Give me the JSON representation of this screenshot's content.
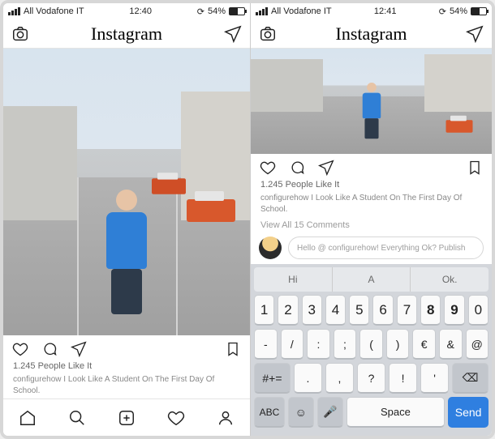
{
  "left": {
    "status": {
      "carrier": "All Vodafone IT",
      "time": "12:40",
      "battery": "54%"
    },
    "header": {
      "logo": "Instagram"
    },
    "post": {
      "likes": "1.245 People Like It",
      "caption": "configurehow I Look Like A Student On The First Day Of School."
    },
    "tabs": [
      "home",
      "search",
      "create",
      "activity",
      "profile"
    ]
  },
  "right": {
    "status": {
      "carrier": "All Vodafone IT",
      "time": "12:41",
      "battery": "54%",
      "battery_icon": "54%"
    },
    "header": {
      "logo": "Instagram"
    },
    "post": {
      "likes": "1.245 People Like It",
      "caption": "configurehow I Look Like A Student On The First Day Of School.",
      "view_comments": "View All 15 Comments",
      "comment_placeholder": "Hello @ configurehow! Everything Ok? Publish"
    },
    "keyboard": {
      "suggestions": [
        "Hi",
        "A",
        "Ok."
      ],
      "row1": [
        "1",
        "2",
        "3",
        "4",
        "5",
        "6",
        "7",
        "8",
        "9",
        "0"
      ],
      "row2": [
        "-",
        "/",
        ":",
        ";",
        "(",
        ")",
        "€",
        "&",
        "@"
      ],
      "row3_labels": {
        "shift": "#+=",
        "keys": [
          ".",
          ",",
          "?",
          "!",
          "'"
        ],
        "del": "⌫"
      },
      "row4": {
        "abc": "ABC",
        "emoji": "☺",
        "mic": "🎤",
        "space": "Space",
        "send": "Send"
      }
    }
  }
}
